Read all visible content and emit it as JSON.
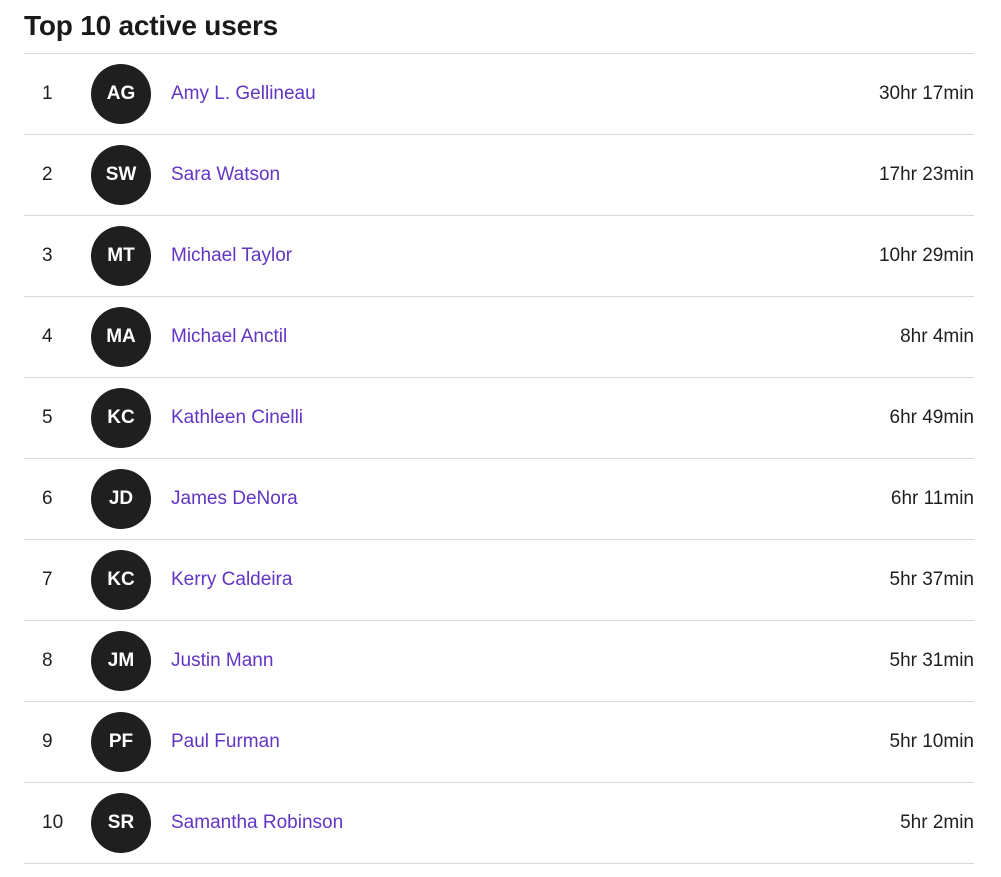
{
  "title": "Top 10 active users",
  "colors": {
    "link": "#6235c4",
    "avatar_bg": "#1f1f20",
    "divider": "#d9d9d9"
  },
  "users": [
    {
      "rank": "1",
      "initials": "AG",
      "name": "Amy L. Gellineau",
      "time": "30hr 17min"
    },
    {
      "rank": "2",
      "initials": "SW",
      "name": "Sara Watson",
      "time": "17hr 23min"
    },
    {
      "rank": "3",
      "initials": "MT",
      "name": "Michael Taylor",
      "time": "10hr 29min"
    },
    {
      "rank": "4",
      "initials": "MA",
      "name": "Michael Anctil",
      "time": "8hr 4min"
    },
    {
      "rank": "5",
      "initials": "KC",
      "name": "Kathleen Cinelli",
      "time": "6hr 49min"
    },
    {
      "rank": "6",
      "initials": "JD",
      "name": "James DeNora",
      "time": "6hr 11min"
    },
    {
      "rank": "7",
      "initials": "KC",
      "name": "Kerry Caldeira",
      "time": "5hr 37min"
    },
    {
      "rank": "8",
      "initials": "JM",
      "name": "Justin Mann",
      "time": "5hr 31min"
    },
    {
      "rank": "9",
      "initials": "PF",
      "name": "Paul Furman",
      "time": "5hr 10min"
    },
    {
      "rank": "10",
      "initials": "SR",
      "name": "Samantha Robinson",
      "time": "5hr 2min"
    }
  ]
}
